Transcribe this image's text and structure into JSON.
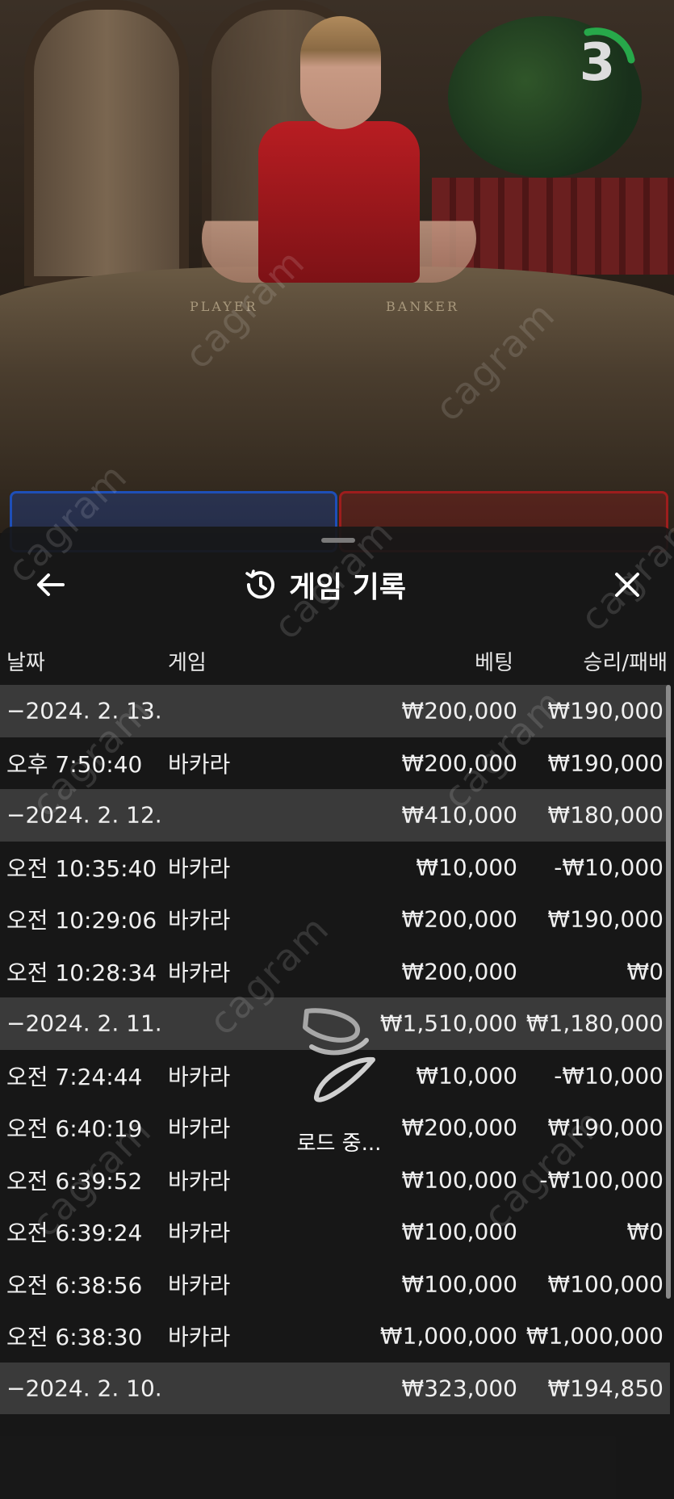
{
  "video": {
    "timer_value": "3",
    "felt_player": "PLAYER",
    "felt_banker": "BANKER",
    "watermark": "cagram"
  },
  "history": {
    "title": "게임 기록",
    "columns": {
      "date": "날짜",
      "game": "게임",
      "bet": "베팅",
      "winloss": "승리/패배"
    },
    "rows": [
      {
        "type": "group",
        "time": "−2024. 2. 13.",
        "game": "",
        "bet": "₩200,000",
        "winloss": "₩190,000"
      },
      {
        "type": "item",
        "time": "오후 7:50:40",
        "game": "바카라",
        "bet": "₩200,000",
        "winloss": "₩190,000"
      },
      {
        "type": "group",
        "time": "−2024. 2. 12.",
        "game": "",
        "bet": "₩410,000",
        "winloss": "₩180,000"
      },
      {
        "type": "item",
        "time": "오전 10:35:40",
        "game": "바카라",
        "bet": "₩10,000",
        "winloss": "-₩10,000"
      },
      {
        "type": "item",
        "time": "오전 10:29:06",
        "game": "바카라",
        "bet": "₩200,000",
        "winloss": "₩190,000"
      },
      {
        "type": "item",
        "time": "오전 10:28:34",
        "game": "바카라",
        "bet": "₩200,000",
        "winloss": "₩0"
      },
      {
        "type": "group",
        "time": "−2024. 2. 11.",
        "game": "",
        "bet": "₩1,510,000",
        "winloss": "₩1,180,000"
      },
      {
        "type": "item",
        "time": "오전 7:24:44",
        "game": "바카라",
        "bet": "₩10,000",
        "winloss": "-₩10,000"
      },
      {
        "type": "item",
        "time": "오전 6:40:19",
        "game": "바카라",
        "bet": "₩200,000",
        "winloss": "₩190,000"
      },
      {
        "type": "item",
        "time": "오전 6:39:52",
        "game": "바카라",
        "bet": "₩100,000",
        "winloss": "-₩100,000"
      },
      {
        "type": "item",
        "time": "오전 6:39:24",
        "game": "바카라",
        "bet": "₩100,000",
        "winloss": "₩0"
      },
      {
        "type": "item",
        "time": "오전 6:38:56",
        "game": "바카라",
        "bet": "₩100,000",
        "winloss": "₩100,000"
      },
      {
        "type": "item",
        "time": "오전 6:38:30",
        "game": "바카라",
        "bet": "₩1,000,000",
        "winloss": "₩1,000,000"
      },
      {
        "type": "group",
        "time": "−2024. 2. 10.",
        "game": "",
        "bet": "₩323,000",
        "winloss": "₩194,850"
      }
    ]
  },
  "loader": {
    "label": "로드 중..."
  },
  "icons": {
    "back": "arrow-left-icon",
    "history": "history-icon",
    "close": "close-icon",
    "loading": "spinner-icon"
  }
}
